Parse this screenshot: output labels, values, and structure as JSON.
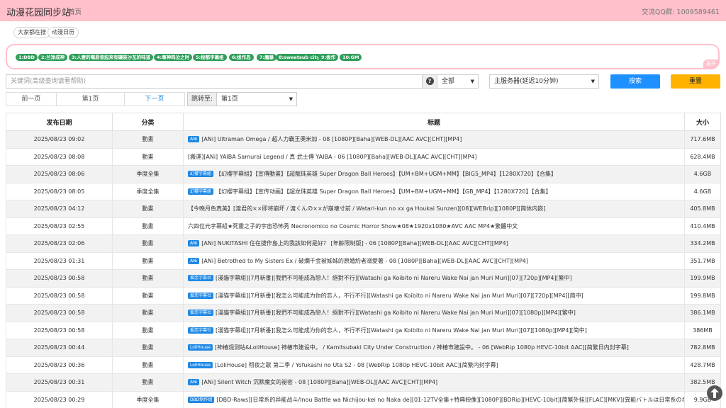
{
  "header": {
    "site_title": "动漫花园同步站",
    "nav_home": "首页",
    "qq_group": "交流QQ群: 1009589461"
  },
  "quick_links": [
    "大家都在搜",
    "动漫日历"
  ],
  "hot_tags": [
    "1:DBD",
    "2:兰净成神",
    "3:人妻的嘴唇曾起来有罐装沙瓦的味道",
    "4:事神鸣泣之时",
    "5:桜都字幕组",
    "6:拔作岛",
    "7:魔暴",
    "8:sweetsub city",
    "9:拔作",
    "10:GM"
  ],
  "expand_label": "展开",
  "search": {
    "placeholder": "关键词(高级查询请看帮助)",
    "category": "全部",
    "server": "主服务器(延迟10分钟)",
    "search_label": "搜索",
    "reset_label": "重置"
  },
  "pager": {
    "prev": "前一页",
    "current": "第1页",
    "next": "下一页",
    "jump_label": "跳转至:",
    "jump_value": "第1页"
  },
  "table": {
    "headers": [
      "发布日期",
      "分类",
      "标题",
      "大小"
    ],
    "rows": [
      {
        "date": "2025/08/23 09:02",
        "cat": "動畫",
        "badge": "ANi",
        "title": "[ANi] Ultraman Omega / 超人力霸王奧米加 - 08 [1080P][Baha][WEB-DL][AAC AVC][CHT][MP4]",
        "size": "717.6MB"
      },
      {
        "date": "2025/08/23 08:08",
        "cat": "動畫",
        "badge": "",
        "title": "[搬運][ANi] YAIBA Samurai Legend / 真·武士傳 YAIBA - 06 [1080P][Baha][WEB-DL][AAC AVC][CHT][MP4]",
        "size": "628.4MB"
      },
      {
        "date": "2025/08/23 08:06",
        "cat": "季度全集",
        "badge": "幻櫻字幕組",
        "title": "【幻櫻字幕組】【宣傳動畫】【超龍珠英雄 Super Dragon Ball Heroes】【UM+BM+UGM+MM】【BIG5_MP4】【1280X720】【合集】",
        "size": "4.6GB"
      },
      {
        "date": "2025/08/23 08:05",
        "cat": "季度全集",
        "badge": "幻櫻字幕組",
        "title": "【幻樱字幕组】【宣传动画】【超龙珠英雄 Super Dragon Ball Heroes】【UM+BM+UGM+MM】【GB_MP4】【1280X720】【合集】",
        "size": "4.6GB"
      },
      {
        "date": "2025/08/23 04:12",
        "cat": "動畫",
        "badge": "",
        "title": "【今晚月色真美】[渡君的××即将崩坏 / 渡くんの××が崩壊寸前 / Watari-kun no xx ga Houkai Sunzen][08][WEBrip][1080P][简体内嵌]",
        "size": "405.8MB"
      },
      {
        "date": "2025/08/23 02:55",
        "cat": "動畫",
        "badge": "",
        "title": "六四位元字幕組★死靈之子的宇宙恐怖秀 Necronomico no Cosmic Horror Show★08★1920x1080★AVC AAC MP4★繁體中文",
        "size": "410.4MB"
      },
      {
        "date": "2025/08/23 02:06",
        "cat": "動畫",
        "badge": "ANi",
        "title": "[ANi] NUKITASHI 住在拔作島上的我該如何是好？ [年齡限制版] - 06 [1080P][Baha][WEB-DL][AAC AVC][CHT][MP4]",
        "size": "334.2MB"
      },
      {
        "date": "2025/08/23 01:31",
        "cat": "動畫",
        "badge": "ANi",
        "title": "[ANi] Betrothed to My Sisters Ex / 破爛千金被姊姊的原婚約者溺愛著 - 08 [1080P][Baha][WEB-DL][AAC AVC][CHT][MP4]",
        "size": "351.7MB"
      },
      {
        "date": "2025/08/23 00:58",
        "cat": "動畫",
        "badge": "爱恋字幕社",
        "title": "[漫貓字幕組][7月新番][我們不可能成為戀人！絕對不行][Watashi ga Koibito ni Nareru Wake Nai jan Muri Muri][07][720p][MP4][繁中]",
        "size": "199.9MB"
      },
      {
        "date": "2025/08/23 00:58",
        "cat": "動畫",
        "badge": "爱恋字幕社",
        "title": "[漫猫字幕组][7月新番][我怎么可能成为你的恋人，不行不行][Watashi ga Koibito ni Nareru Wake Nai jan Muri Muri][07][720p][MP4][简中]",
        "size": "199.8MB"
      },
      {
        "date": "2025/08/23 00:58",
        "cat": "動畫",
        "badge": "爱恋字幕社",
        "title": "[漫貓字幕組][7月新番][我們不可能成為戀人！絕對不行][Watashi ga Koibito ni Nareru Wake Nai jan Muri Muri][07][1080p][MP4][繁中]",
        "size": "386.1MB"
      },
      {
        "date": "2025/08/23 00:58",
        "cat": "動畫",
        "badge": "爱恋字幕社",
        "title": "[漫猫字幕组][7月新番][我怎么可能成为你的恋人，不行不行][Watashi ga Koibito ni Nareru Wake Nai jan Muri Muri][07][1080p][MP4][简中]",
        "size": "386MB"
      },
      {
        "date": "2025/08/23 00:44",
        "cat": "動畫",
        "badge": "LoliHouse",
        "title": "[神椿观测站&LoliHouse] 神椿市建设中。 / Kamitsubaki City Under Construction / 神椿市建設中。 - 06 [WebRip 1080p HEVC-10bit AAC][简繁日内封字幕]",
        "size": "782.8MB"
      },
      {
        "date": "2025/08/23 00:36",
        "cat": "動畫",
        "badge": "LoliHouse",
        "title": "[LoliHouse] 彻夜之歌 第二季 / Yofukashi no Uta S2 - 08 [WebRip 1080p HEVC-10bit AAC][简繁内封字幕]",
        "size": "428.7MB"
      },
      {
        "date": "2025/08/23 00:31",
        "cat": "動畫",
        "badge": "ANi",
        "title": "[ANi] Silent Witch 沉默魔女的祕密 - 08 [1080P][Baha][WEB-DL][AAC AVC][CHT][MP4]",
        "size": "382.5MB"
      },
      {
        "date": "2025/08/23 00:29",
        "cat": "季度全集",
        "badge": "DBD制作组",
        "title": "[DBD-Raws][日常系的异能战斗/Inou Battle wa Nichijou-kei no Naka de][01-12TV全集+特典映像][1080P][BDRip][HEVC-10bit][简繁外挂][FLAC][MKV](異能バトルは日常系のなかで)",
        "size": "9.9GB"
      }
    ]
  },
  "colors": {
    "header_bg": "#ffc0cb",
    "tag_green": "#2e9e58",
    "badge_blue": "#1e88e5",
    "search_blue": "#1e90ff",
    "reset_amber": "#ffb300"
  },
  "icons": {
    "help": "question-circle-icon",
    "back_to_top": "arrow-up-icon"
  }
}
